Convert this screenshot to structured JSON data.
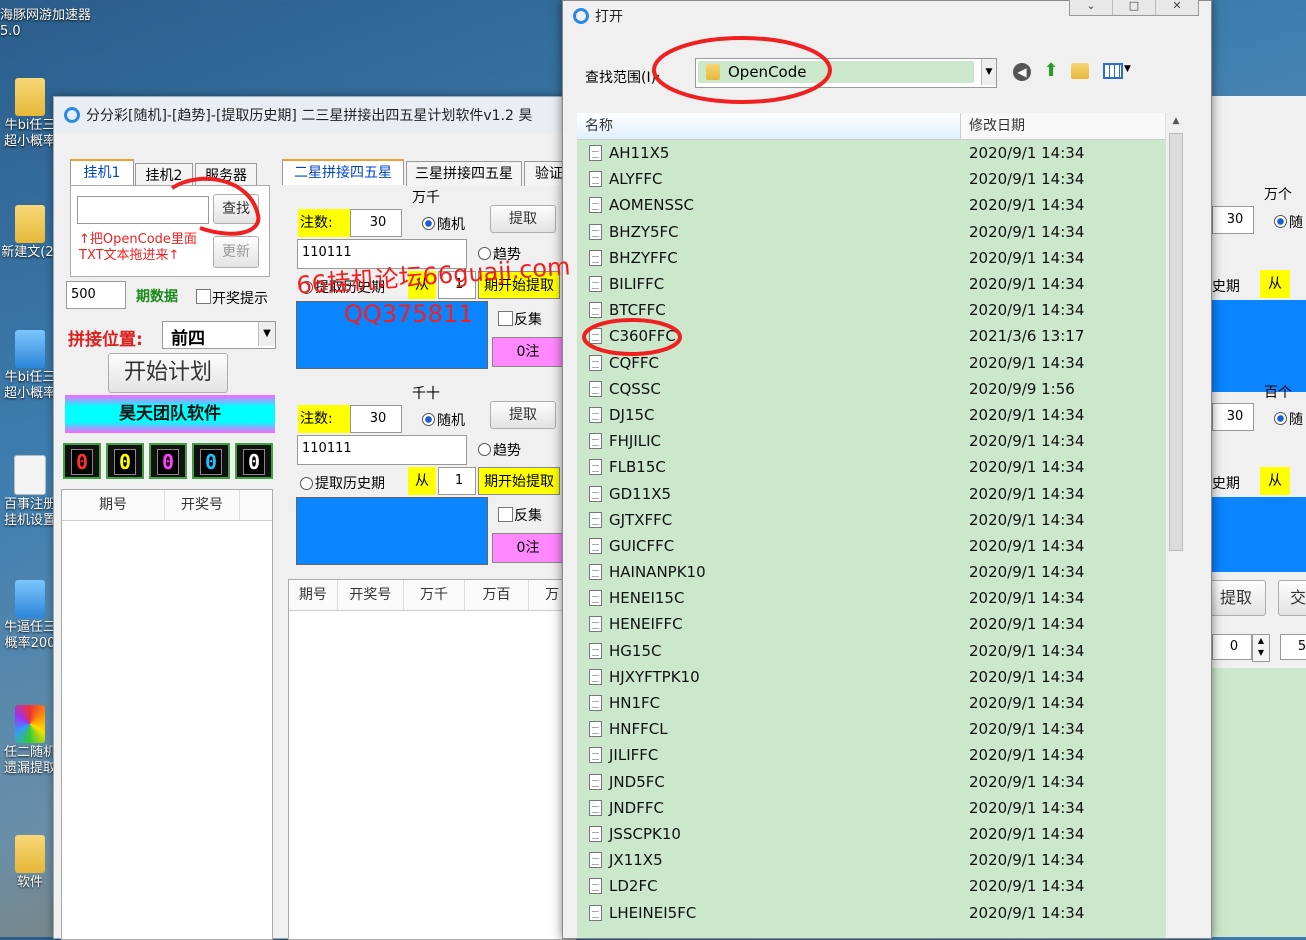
{
  "desktop": {
    "icons": [
      {
        "label": "海豚网游加速器5.0",
        "icon": "app-icon"
      },
      {
        "label": "牛bi任三超小概率",
        "icon": "folder-icon"
      },
      {
        "label": "新建文(2)",
        "icon": "folder-icon"
      },
      {
        "label": "牛bi任三超小概率",
        "icon": "app-icon"
      },
      {
        "label": "百事注册挂机设置",
        "icon": "file-icon"
      },
      {
        "label": "牛逼任三概率200",
        "icon": "app-icon"
      },
      {
        "label": "任二随机遗漏提取",
        "icon": "color-icon"
      },
      {
        "label": "软件",
        "icon": "folder-icon"
      }
    ]
  },
  "main_window": {
    "title": "分分彩[随机]-[趋势]-[提取历史期] 二三星拼接出四五星计划软件v1.2 昊",
    "left_tabs": [
      "挂机1",
      "挂机2",
      "服务器"
    ],
    "search_button": "查找",
    "update_button": "更新",
    "hint_line1": "↑把OpenCode里面",
    "hint_line2": "TXT文本拖进来↑",
    "periods_value": "500",
    "periods_label": "期数据",
    "lottery_hint_label": "开奖提示",
    "splice_label": "拼接位置:",
    "splice_value": "前四",
    "start_button": "开始计划",
    "team_banner": "昊天团队软件",
    "digits": [
      "0",
      "0",
      "0",
      "0",
      "0"
    ],
    "left_grid_headers": [
      "期号",
      "开奖号"
    ],
    "right_tabs": [
      "二星拼接四五星",
      "三星拼接四五星",
      "验证"
    ],
    "panels": [
      {
        "title": "万千",
        "bets_label": "注数:",
        "bets_value": "30",
        "random_label": "随机",
        "extract_button": "提取",
        "code_value": "110111",
        "trend_label": "趋势",
        "history_label": "提取历史期",
        "from_label": "从",
        "from_value": "1",
        "start_extract": "期开始提取",
        "reverse_label": "反集",
        "count_label": "0注"
      },
      {
        "title": "千十",
        "bets_label": "注数:",
        "bets_value": "30",
        "random_label": "随机",
        "extract_button": "提取",
        "code_value": "110111",
        "trend_label": "趋势",
        "history_label": "提取历史期",
        "from_label": "从",
        "from_value": "1",
        "start_extract": "期开始提取",
        "reverse_label": "反集",
        "count_label": "0注"
      }
    ],
    "bottom_grid_headers": [
      "期号",
      "开奖号",
      "万千",
      "万百",
      "万"
    ]
  },
  "right_window": {
    "label_wange": "万个",
    "label_baige": "百个",
    "bets_value_1": "30",
    "bets_value_2": "30",
    "random_label": "随",
    "history_label": "i史期",
    "from_label": "从",
    "extract_button": "提取",
    "cross_button": "交",
    "spin_value_1": "0",
    "spin_value_2": "5"
  },
  "open_dialog": {
    "title": "打开",
    "look_in_label": "查找范围(I):",
    "look_in_value": "OpenCode",
    "col_name": "名称",
    "col_date": "修改日期",
    "files": [
      {
        "name": "AH11X5",
        "date": "2020/9/1 14:34"
      },
      {
        "name": "ALYFFC",
        "date": "2020/9/1 14:34"
      },
      {
        "name": "AOMENSSC",
        "date": "2020/9/1 14:34"
      },
      {
        "name": "BHZY5FC",
        "date": "2020/9/1 14:34"
      },
      {
        "name": "BHZYFFC",
        "date": "2020/9/1 14:34"
      },
      {
        "name": "BILIFFC",
        "date": "2020/9/1 14:34"
      },
      {
        "name": "BTCFFC",
        "date": "2020/9/1 14:34"
      },
      {
        "name": "C360FFC",
        "date": "2021/3/6 13:17"
      },
      {
        "name": "CQFFC",
        "date": "2020/9/1 14:34"
      },
      {
        "name": "CQSSC",
        "date": "2020/9/9 1:56"
      },
      {
        "name": "DJ15C",
        "date": "2020/9/1 14:34"
      },
      {
        "name": "FHJILIC",
        "date": "2020/9/1 14:34"
      },
      {
        "name": "FLB15C",
        "date": "2020/9/1 14:34"
      },
      {
        "name": "GD11X5",
        "date": "2020/9/1 14:34"
      },
      {
        "name": "GJTXFFC",
        "date": "2020/9/1 14:34"
      },
      {
        "name": "GUICFFC",
        "date": "2020/9/1 14:34"
      },
      {
        "name": "HAINANPK10",
        "date": "2020/9/1 14:34"
      },
      {
        "name": "HENEI15C",
        "date": "2020/9/1 14:34"
      },
      {
        "name": "HENEIFFC",
        "date": "2020/9/1 14:34"
      },
      {
        "name": "HG15C",
        "date": "2020/9/1 14:34"
      },
      {
        "name": "HJXYFTPK10",
        "date": "2020/9/1 14:34"
      },
      {
        "name": "HN1FC",
        "date": "2020/9/1 14:34"
      },
      {
        "name": "HNFFCL",
        "date": "2020/9/1 14:34"
      },
      {
        "name": "JILIFFC",
        "date": "2020/9/1 14:34"
      },
      {
        "name": "JND5FC",
        "date": "2020/9/1 14:34"
      },
      {
        "name": "JNDFFC",
        "date": "2020/9/1 14:34"
      },
      {
        "name": "JSSCPK10",
        "date": "2020/9/1 14:34"
      },
      {
        "name": "JX11X5",
        "date": "2020/9/1 14:34"
      },
      {
        "name": "LD2FC",
        "date": "2020/9/1 14:34"
      },
      {
        "name": "LHEINEI5FC",
        "date": "2020/9/1 14:34"
      }
    ]
  },
  "watermark": {
    "line1": "66挂机论坛66guaji.com",
    "line2": "QQ375811"
  },
  "colors": {
    "accent_blue": "#0a84ff",
    "highlight_yellow": "#ffff00",
    "count_pink": "#ff88ff",
    "file_list_bg": "#cce8cc",
    "annotation_red": "#f02020"
  }
}
